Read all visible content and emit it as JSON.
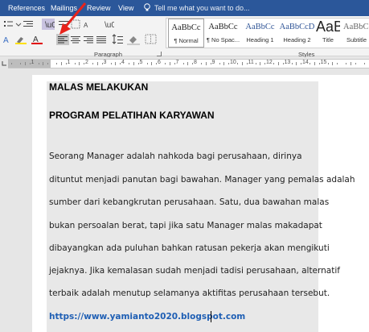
{
  "tabs": [
    "References",
    "Mailings",
    "Review",
    "View"
  ],
  "tell_me": "Tell me what you want to do...",
  "ribbon": {
    "paragraph_label": "Paragraph",
    "styles_label": "Styles"
  },
  "styles": [
    {
      "preview": "AaBbCc",
      "label": "¶ Normal"
    },
    {
      "preview": "AaBbCc",
      "label": "¶ No Spac..."
    },
    {
      "preview": "AaBbCc",
      "label": "Heading 1"
    },
    {
      "preview": "AaBbCcD",
      "label": "Heading 2"
    },
    {
      "preview": "AaB",
      "label": "Title"
    },
    {
      "preview": "AaBbCcD",
      "label": "Subtitle"
    }
  ],
  "ruler_numbers": [
    "1",
    "1",
    "2",
    "3",
    "4",
    "5",
    "6",
    "7",
    "8",
    "9",
    "10",
    "11",
    "12",
    "13",
    "14",
    "15"
  ],
  "document": {
    "heading1": "MALAS MELAKUKAN",
    "heading2": "PROGRAM PELATIHAN KARYAWAN",
    "lines": [
      "        Seorang Manager adalah nahkoda bagi perusahaan, dirinya",
      "dituntut menjadi panutan bagi bawahan. Manager yang pemalas adalah",
      "sumber dari kebangkrutan perusahaan. Satu, dua bawahan malas",
      "bukan persoalan berat, tapi jika satu Manager malas makadapat",
      "dibayangkan ada puluhan bahkan ratusan pekerja akan mengikuti",
      "jejaknya. Jika kemalasan sudah menjadi tadisi perusahaan, alternatif",
      "terbaik adalah menutup selamanya aktifitas perusahaan tersebut."
    ],
    "link": "https://www.yamianto2020.blogspot.com"
  },
  "colors": {
    "ribbon_tab_bg": "#2b579a",
    "selection_bg": "#e8e8e8",
    "link": "#1f5fb4",
    "arrow": "#e8231b"
  },
  "icons": {
    "align_left": "align-left-icon",
    "align_center": "align-center-icon",
    "align_right": "align-right-icon",
    "justify": "justify-icon"
  }
}
